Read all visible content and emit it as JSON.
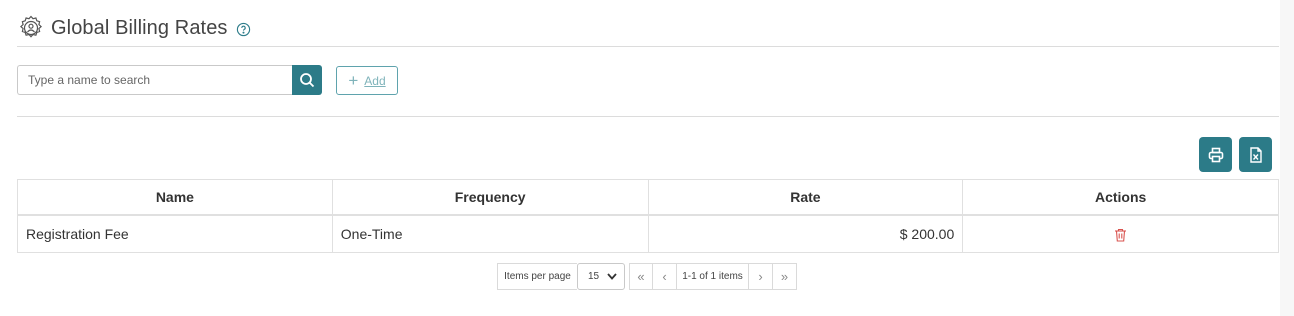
{
  "page": {
    "title": "Global Billing Rates",
    "header_icon": "settings-person-icon",
    "help_icon": "question-circle-icon"
  },
  "toolbar": {
    "search_placeholder": "Type a name to search",
    "search_value": "",
    "search_icon": "search-icon",
    "add_label": "Add",
    "add_icon": "plus-icon",
    "print_icon": "printer-icon",
    "excel_icon": "excel-export-icon"
  },
  "table": {
    "columns": [
      "Name",
      "Frequency",
      "Rate",
      "Actions"
    ],
    "rows": [
      {
        "name": "Registration Fee",
        "frequency": "One-Time",
        "rate": "$ 200.00",
        "action_icon": "trash-icon"
      }
    ]
  },
  "pager": {
    "items_per_page_label": "Items per page",
    "items_per_page_value": "15",
    "info": "1-1 of 1 items",
    "first": "«",
    "prev": "‹",
    "next": "›",
    "last": "»"
  },
  "colors": {
    "accent": "#2c7b88",
    "danger": "#d9534f",
    "border": "#e0e0e0"
  }
}
